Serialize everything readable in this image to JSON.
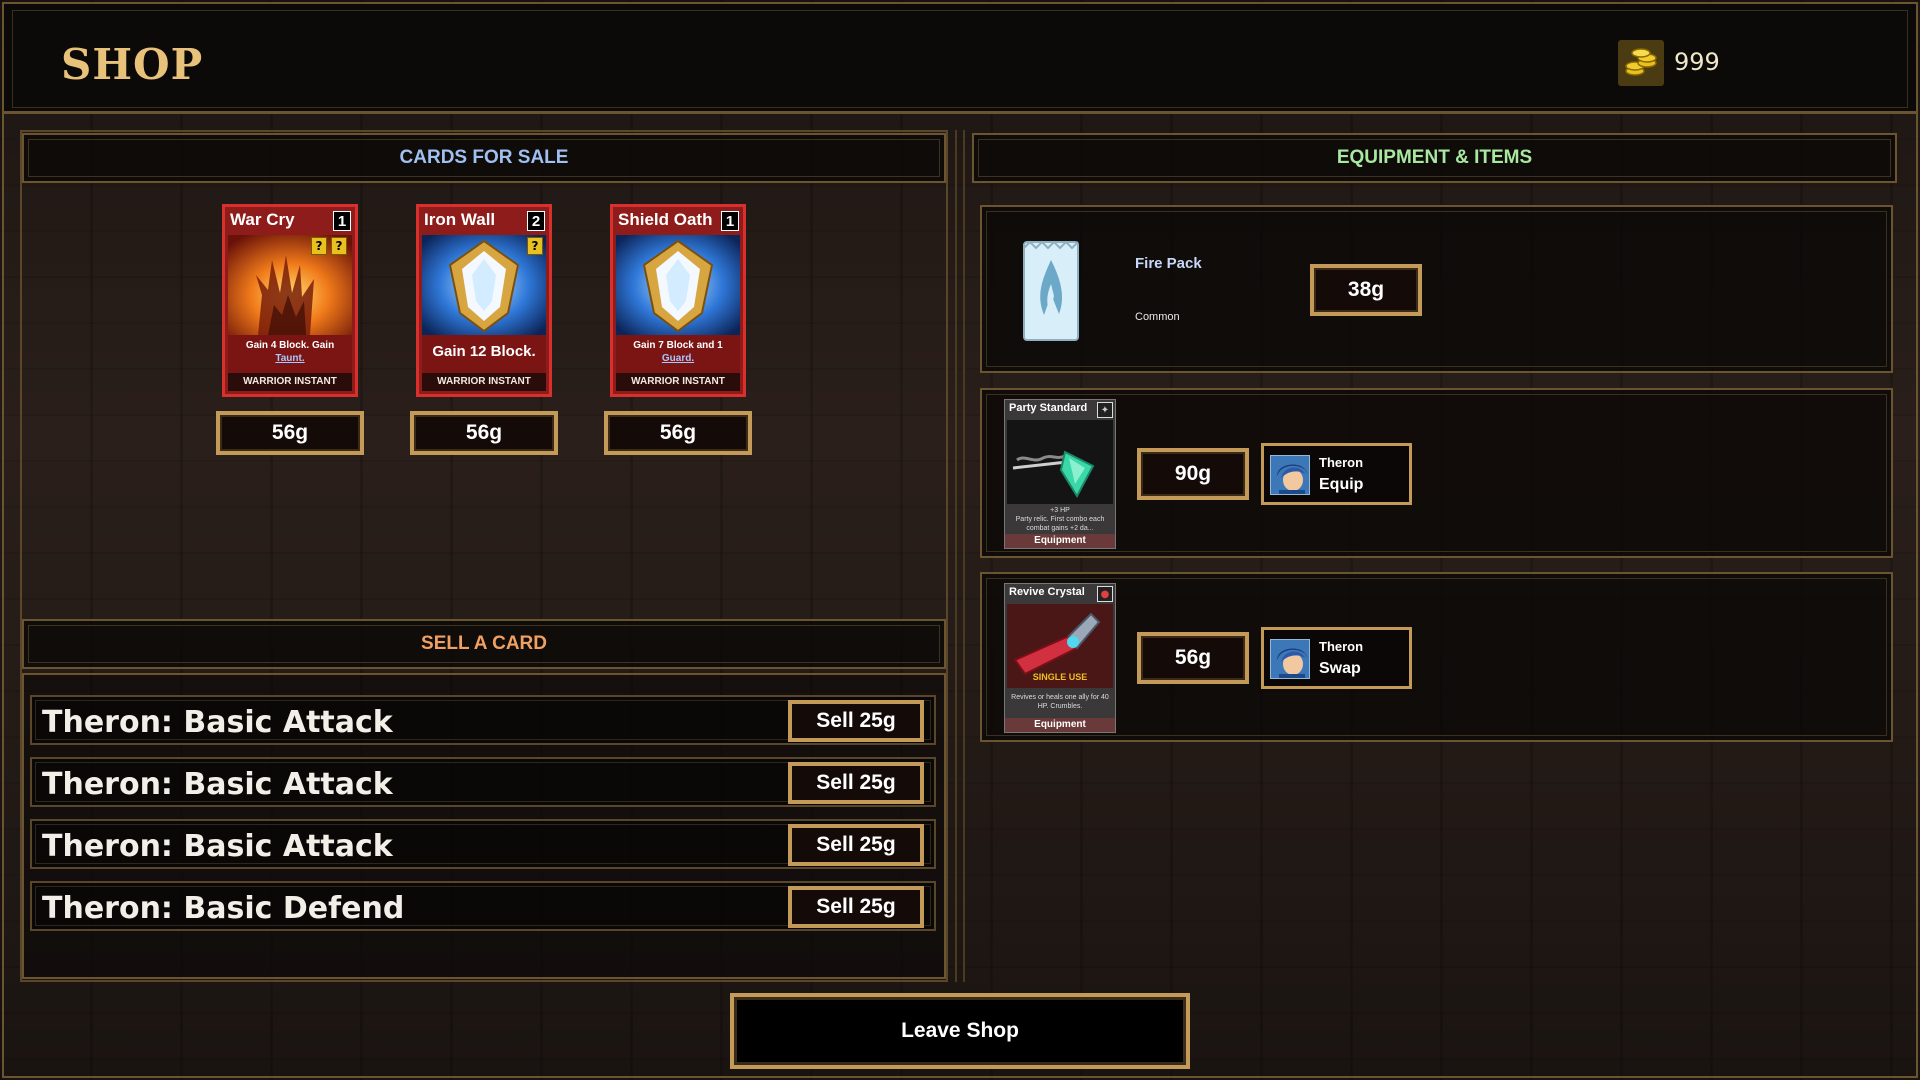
{
  "header": {
    "title": "SHOP",
    "gold": "999",
    "gold_icon": "gold-coins-icon"
  },
  "cards_panel": {
    "title": "CARDS FOR SALE",
    "title_color": "#9fc0f0",
    "cards": [
      {
        "name": "War Cry",
        "cost": "1",
        "desc_line1": "Gain 4 Block. Gain",
        "desc_line2": "Taunt.",
        "type": "WARRIOR INSTANT",
        "price": "56g",
        "art": "fire-hand-icon"
      },
      {
        "name": "Iron Wall",
        "cost": "2",
        "desc_line1": "Gain 12 Block.",
        "desc_line2": "",
        "type": "WARRIOR INSTANT",
        "price": "56g",
        "art": "shield-crest-icon"
      },
      {
        "name": "Shield Oath",
        "cost": "1",
        "desc_line1": "Gain 7 Block and 1",
        "desc_line2": "Guard.",
        "type": "WARRIOR INSTANT",
        "price": "56g",
        "art": "shield-crest-icon"
      }
    ]
  },
  "sell_panel": {
    "title": "SELL A CARD",
    "title_color": "#f0a060",
    "rows": [
      {
        "label": "Theron: Basic Attack",
        "button": "Sell 25g"
      },
      {
        "label": "Theron: Basic Attack",
        "button": "Sell 25g"
      },
      {
        "label": "Theron: Basic Attack",
        "button": "Sell 25g"
      },
      {
        "label": "Theron: Basic Defend",
        "button": "Sell 25g"
      }
    ]
  },
  "equipment_panel": {
    "title": "EQUIPMENT & ITEMS",
    "title_color": "#a8e8a0",
    "pack": {
      "name": "Fire Pack",
      "rarity": "Common",
      "price": "38g",
      "icon": "card-pack-icon"
    },
    "items": [
      {
        "card_name": "Party Standard",
        "desc_top": "+3 HP",
        "desc": "Party relic. First combo each combat gains +2 da...",
        "card_type": "Equipment",
        "price": "90g",
        "hero": "Theron",
        "action": "Equip",
        "art": "banner-spear-icon",
        "badge": "relic-icon"
      },
      {
        "card_name": "Revive Crystal",
        "desc_top": "SINGLE USE",
        "desc": "Revives or heals one ally for 40 HP. Crumbles.",
        "card_type": "Equipment",
        "price": "56g",
        "hero": "Theron",
        "action": "Swap",
        "art": "crystal-dagger-icon",
        "badge": "potion-icon"
      }
    ]
  },
  "footer": {
    "leave_label": "Leave Shop"
  },
  "colors": {
    "frame_gold": "#c49a58",
    "card_red": "#d8302d",
    "title_gold": "#e8c27a"
  }
}
